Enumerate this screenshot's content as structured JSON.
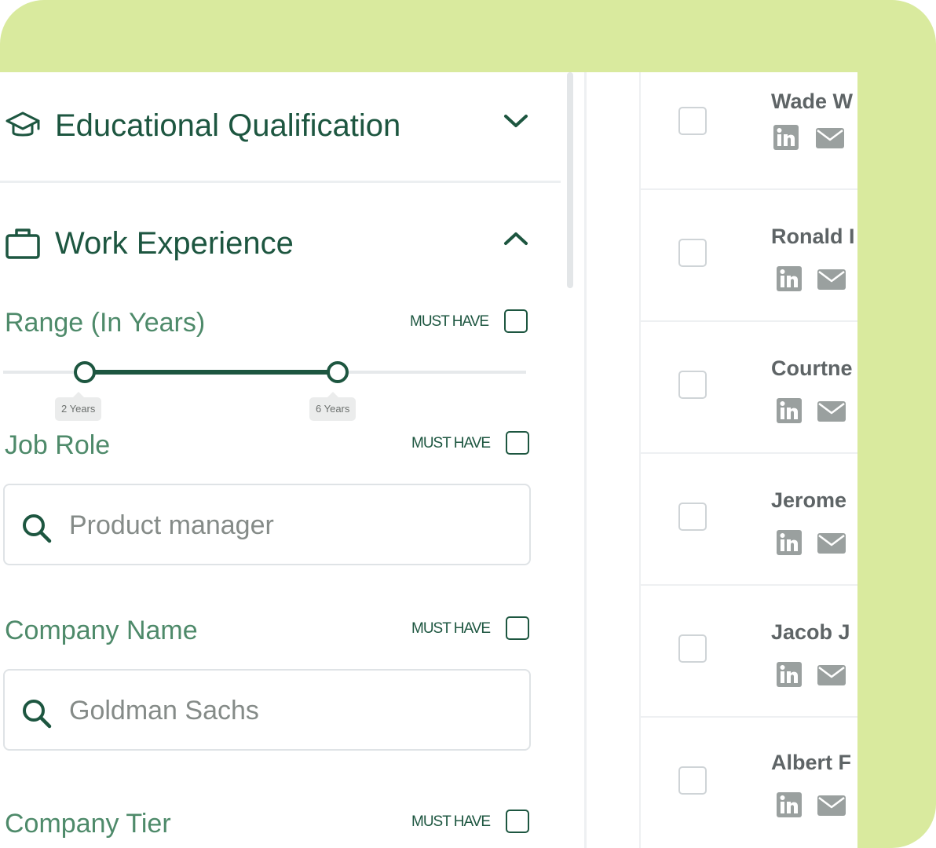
{
  "filters": {
    "educational": {
      "title": "Educational Qualification",
      "icon": "graduation-cap-icon",
      "expanded": false
    },
    "work": {
      "title": "Work Experience",
      "icon": "briefcase-icon",
      "expanded": true,
      "range": {
        "label": "Range (In Years)",
        "must_have": "MUST HAVE",
        "min_label": "2 Years",
        "max_label": "6 Years"
      },
      "job_role": {
        "label": "Job Role",
        "must_have": "MUST HAVE",
        "value": "Product manager"
      },
      "company_name": {
        "label": "Company Name",
        "must_have": "MUST HAVE",
        "value": "Goldman Sachs"
      },
      "company_tier": {
        "label": "Company Tier",
        "must_have": "MUST HAVE"
      }
    }
  },
  "candidates": [
    {
      "name": "Wade W"
    },
    {
      "name": "Ronald I"
    },
    {
      "name": "Courtne"
    },
    {
      "name": "Jerome"
    },
    {
      "name": "Jacob J"
    },
    {
      "name": "Albert F"
    }
  ],
  "colors": {
    "frame": "#d9ea9e",
    "brand_green": "#1d5640",
    "label_green": "#4e8a6a"
  }
}
